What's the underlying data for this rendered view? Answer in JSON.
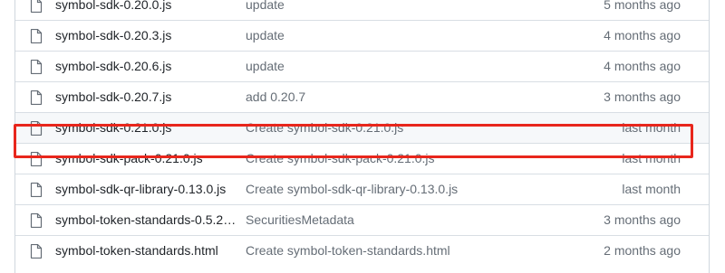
{
  "file_list": {
    "rows": [
      {
        "icon": "file-icon",
        "name": "symbol-sdk-0.20.0.js",
        "commit": "update",
        "age": "5 months ago"
      },
      {
        "icon": "file-icon",
        "name": "symbol-sdk-0.20.3.js",
        "commit": "update",
        "age": "4 months ago"
      },
      {
        "icon": "file-icon",
        "name": "symbol-sdk-0.20.6.js",
        "commit": "update",
        "age": "4 months ago"
      },
      {
        "icon": "file-icon",
        "name": "symbol-sdk-0.20.7.js",
        "commit": "add 0.20.7",
        "age": "3 months ago"
      },
      {
        "icon": "file-icon",
        "name": "symbol-sdk-0.21.0.js",
        "commit": "Create symbol-sdk-0.21.0.js",
        "age": "last month"
      },
      {
        "icon": "file-icon",
        "name": "symbol-sdk-pack-0.21.0.js",
        "commit": "Create symbol-sdk-pack-0.21.0.js",
        "age": "last month"
      },
      {
        "icon": "file-icon",
        "name": "symbol-sdk-qr-library-0.13.0.js",
        "commit": "Create symbol-sdk-qr-library-0.13.0.js",
        "age": "last month"
      },
      {
        "icon": "file-icon",
        "name": "symbol-token-standards-0.5.2…",
        "commit": "SecuritiesMetadata",
        "age": "3 months ago"
      },
      {
        "icon": "file-icon",
        "name": "symbol-token-standards.html",
        "commit": "Create symbol-token-standards.html",
        "age": "2 months ago"
      }
    ]
  },
  "annotation": {
    "highlight_color": "#e8261c"
  }
}
